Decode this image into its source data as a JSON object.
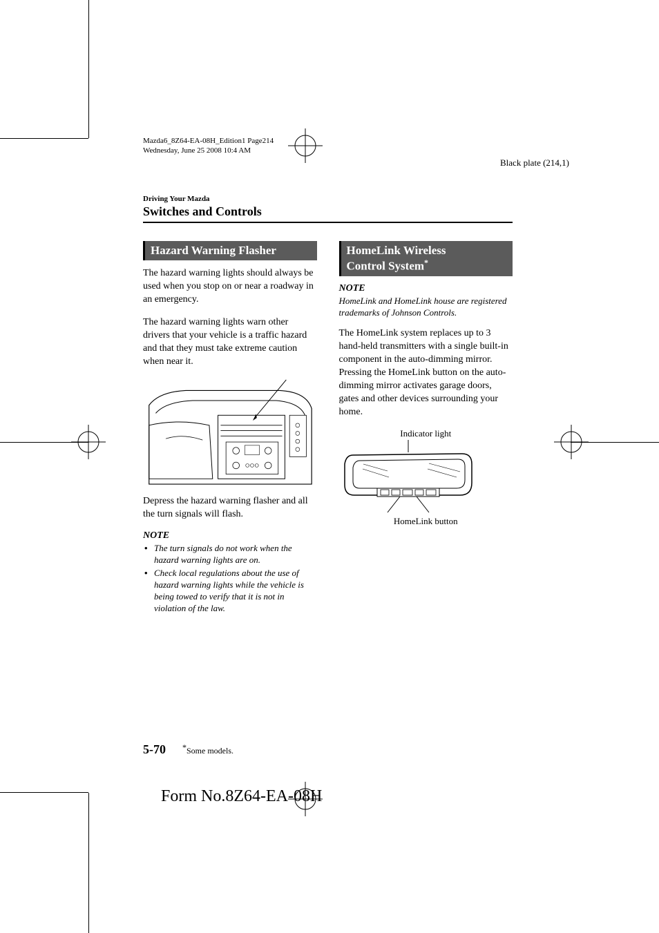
{
  "print_header_line1": "Mazda6_8Z64-EA-08H_Edition1 Page214",
  "print_header_line2": "Wednesday, June 25 2008 10:4 AM",
  "black_plate": "Black plate (214,1)",
  "chapter_label": "Driving Your Mazda",
  "chapter_title": "Switches and Controls",
  "left": {
    "heading": "Hazard Warning Flasher",
    "p1": "The hazard warning lights should always be used when you stop on or near a roadway in an emergency.",
    "p2": "The hazard warning lights warn other drivers that your vehicle is a traffic hazard and that they must take extreme caution when near it.",
    "p3": "Depress the hazard warning flasher and all the turn signals will flash.",
    "note_label": "NOTE",
    "note_item1": "The turn signals do not work when the hazard warning lights are on.",
    "note_item2": "Check local regulations about the use of hazard warning lights while the vehicle is being towed to verify that it is not in violation of the law."
  },
  "right": {
    "heading_line1": "HomeLink Wireless",
    "heading_line2": "Control System",
    "note_label": "NOTE",
    "note_text": "HomeLink and HomeLink house are registered trademarks of Johnson Controls.",
    "p1": "The HomeLink system replaces up to 3 hand-held transmitters with a single built-in component in the auto-dimming mirror. Pressing the HomeLink button on the auto-dimming mirror activates garage doors, gates and other devices surrounding your home.",
    "fig_label_top": "Indicator light",
    "fig_label_bottom": "HomeLink button"
  },
  "page_number": "5-70",
  "footer_note": "Some models.",
  "form_no": "Form No.8Z64-EA-08H"
}
